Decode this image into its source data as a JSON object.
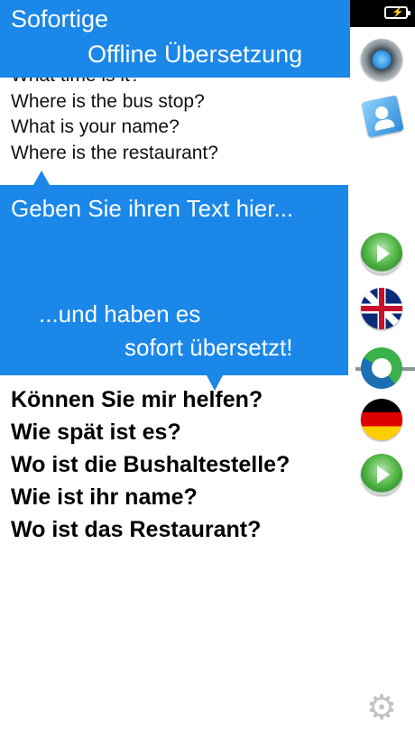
{
  "promo": {
    "title_line1": "Sofortige",
    "title_line2": "Offline Übersetzung",
    "hint_line1": "Geben Sie ihren Text hier...",
    "hint_line2": "...und haben es",
    "hint_line3": "sofort übersetzt!"
  },
  "source": {
    "language": "English",
    "lines": [
      "What time is it?",
      "Where is the bus stop?",
      "What is your name?",
      "Where is the restaurant?"
    ]
  },
  "target": {
    "language": "German",
    "lines": [
      "Können Sie mir helfen?",
      "Wie spät ist es?",
      "Wo ist die Bushaltestelle?",
      "Wie ist ihr name?",
      "Wo ist das Restaurant?"
    ]
  },
  "icons": {
    "record": "record-icon",
    "contacts": "contacts-icon",
    "play_source": "play-icon",
    "source_flag": "uk-flag-icon",
    "swap": "swap-icon",
    "target_flag": "german-flag-icon",
    "play_target": "play-icon",
    "settings": "gear-icon"
  },
  "colors": {
    "callout": "#1a87e9",
    "play": "#55b948"
  }
}
